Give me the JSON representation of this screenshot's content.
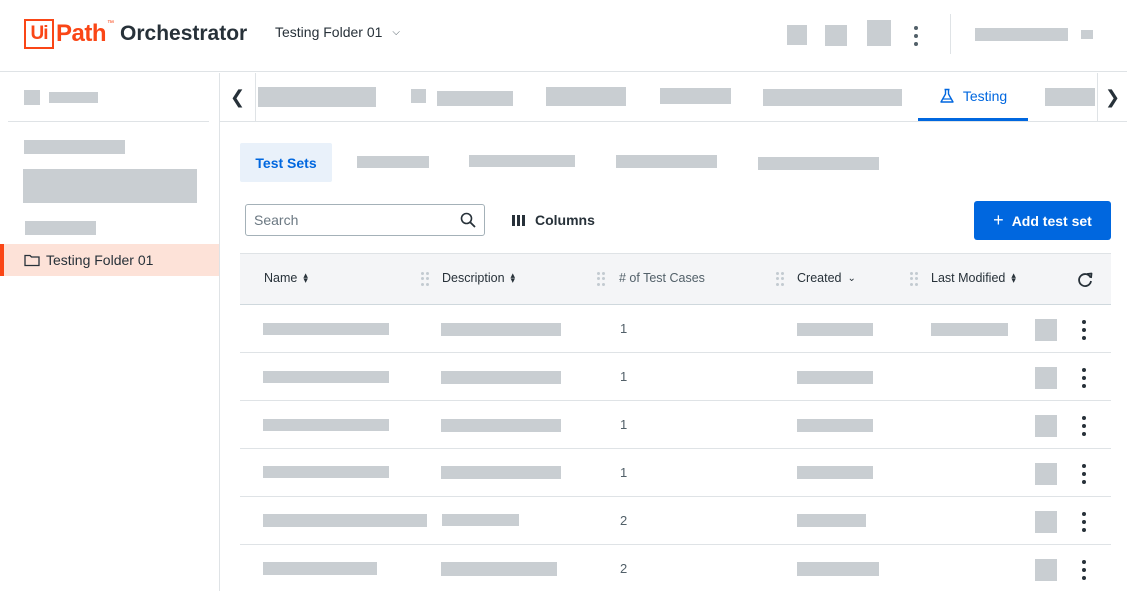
{
  "header": {
    "brand_ui": "Ui",
    "brand_path": "Path",
    "brand_tm": "™",
    "product": "Orchestrator",
    "folder_selector": "Testing Folder 01"
  },
  "sidebar": {
    "selected_folder": "Testing Folder 01"
  },
  "tabs": {
    "active_label": "Testing"
  },
  "subtabs": {
    "active_label": "Test Sets"
  },
  "toolbar": {
    "search_placeholder": "Search",
    "columns_label": "Columns",
    "add_label": "Add test set"
  },
  "table": {
    "columns": [
      "Name",
      "Description",
      "# of Test Cases",
      "Created",
      "Last Modified"
    ],
    "rows": [
      {
        "test_cases": "1"
      },
      {
        "test_cases": "1"
      },
      {
        "test_cases": "1"
      },
      {
        "test_cases": "1"
      },
      {
        "test_cases": "2"
      },
      {
        "test_cases": "2"
      }
    ]
  },
  "colors": {
    "brand": "#fa4616",
    "accent": "#0067df",
    "placeholder_block": "#c9ced2"
  }
}
